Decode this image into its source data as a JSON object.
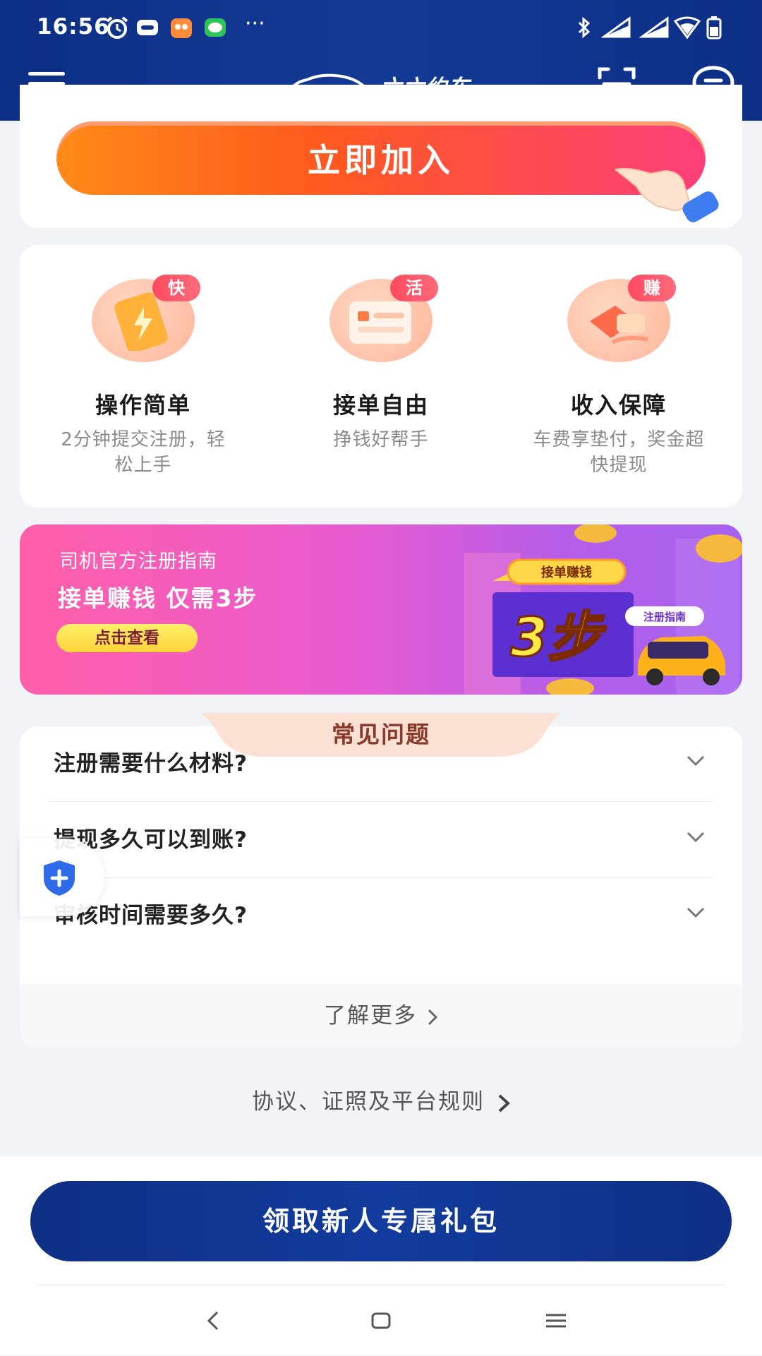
{
  "status_bar": {
    "time": "16:56",
    "more": "···"
  },
  "header": {
    "brand_name": "六六约车",
    "menu_icon": "hamburger-icon",
    "scan_icon": "scan-icon",
    "message_icon": "message-icon",
    "brand_color": "#0d2f86"
  },
  "join": {
    "label": "立即加入"
  },
  "features": [
    {
      "tag": "快",
      "title": "操作简单",
      "desc": "2分钟提交注册，轻松上手"
    },
    {
      "tag": "活",
      "title": "接单自由",
      "desc": "挣钱好帮手"
    },
    {
      "tag": "赚",
      "title": "收入保障",
      "desc": "车费享垫付，奖金超快提现"
    }
  ],
  "banner": {
    "sub": "司机官方注册指南",
    "headline": "接单赚钱 仅需3步",
    "button": "点击查看",
    "art_ribbon": "接单赚钱",
    "art_big": "3步",
    "art_tag": "注册指南"
  },
  "faq": {
    "title": "常见问题",
    "items": [
      {
        "q": "注册需要什么材料?"
      },
      {
        "q": "提现多久可以到账?"
      },
      {
        "q": "审核时间需要多久?"
      }
    ],
    "more": "了解更多"
  },
  "rules_link": "协议、证照及平台规则",
  "gift_button": "领取新人专属礼包",
  "colors": {
    "accent_orange": "#ff5a1e",
    "accent_pink": "#ff3f7a",
    "nav_blue": "#0e2f84"
  }
}
